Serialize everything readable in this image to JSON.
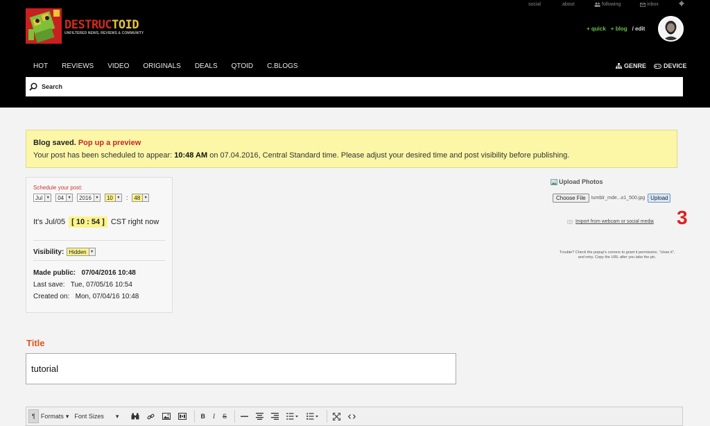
{
  "top_links": {
    "social": "social",
    "about": "about",
    "following": "following",
    "inbox": "inbox"
  },
  "logo": {
    "part1": "DESTRUC",
    "part2": "TOID",
    "tagline": "UNFILTERED NEWS, REVIEWS & COMMUNITY"
  },
  "user_actions": {
    "quick": "+ quick",
    "blog": "+ blog",
    "edit": "/ edit"
  },
  "nav": {
    "items": [
      "HOT",
      "REVIEWS",
      "VIDEO",
      "ORIGINALS",
      "DEALS",
      "QTOID",
      "C.BLOGS"
    ],
    "genre": "GENRE",
    "device": "DEVICE"
  },
  "search": {
    "placeholder": "Search"
  },
  "alert": {
    "saved": "Blog saved.",
    "preview_link": "Pop up a preview",
    "msg_before": "Your post has been scheduled to appear:",
    "time": "10:48 AM",
    "msg_after": "on 07.04.2016, Central Standard time. Please adjust your desired time and post visibility before publishing."
  },
  "schedule": {
    "label": "Schedule your post:",
    "month": "Jul",
    "day": "04",
    "year": "2016",
    "hour": "10",
    "minute": "48",
    "now_prefix": "It's Jul/05",
    "now_time": "[ 10 : 54 ]",
    "now_suffix": "CST right now",
    "visibility_label": "Visibility:",
    "visibility_value": "Hidden",
    "made_public_label": "Made public:",
    "made_public_value": "07/04/2016 10:48",
    "last_save_label": "Last save:",
    "last_save_value": "Tue, 07/05/16 10:54",
    "created_label": "Created on:",
    "created_value": "Mon, 07/04/16 10:48"
  },
  "upload": {
    "title": "Upload Photos",
    "choose_file": "Choose File",
    "file_name": "tumblr_mde...o1_500.jpg",
    "upload_button": "Upload",
    "import_link": "Import from webcam or social media",
    "step_number": "3",
    "trouble": "Trouble? Check the popup's corners to grant it permission, \"close it\", and retry. Copy the URL after you take the pic."
  },
  "title_section": {
    "label": "Title",
    "value": "tutorial"
  },
  "toolbar": {
    "formats": "Formats",
    "font_sizes": "Font Sizes"
  },
  "colors": {
    "accent_red": "#c6282b",
    "title_orange": "#e2541e",
    "green": "#6cc24a",
    "alert_bg": "#fbf7a7"
  }
}
